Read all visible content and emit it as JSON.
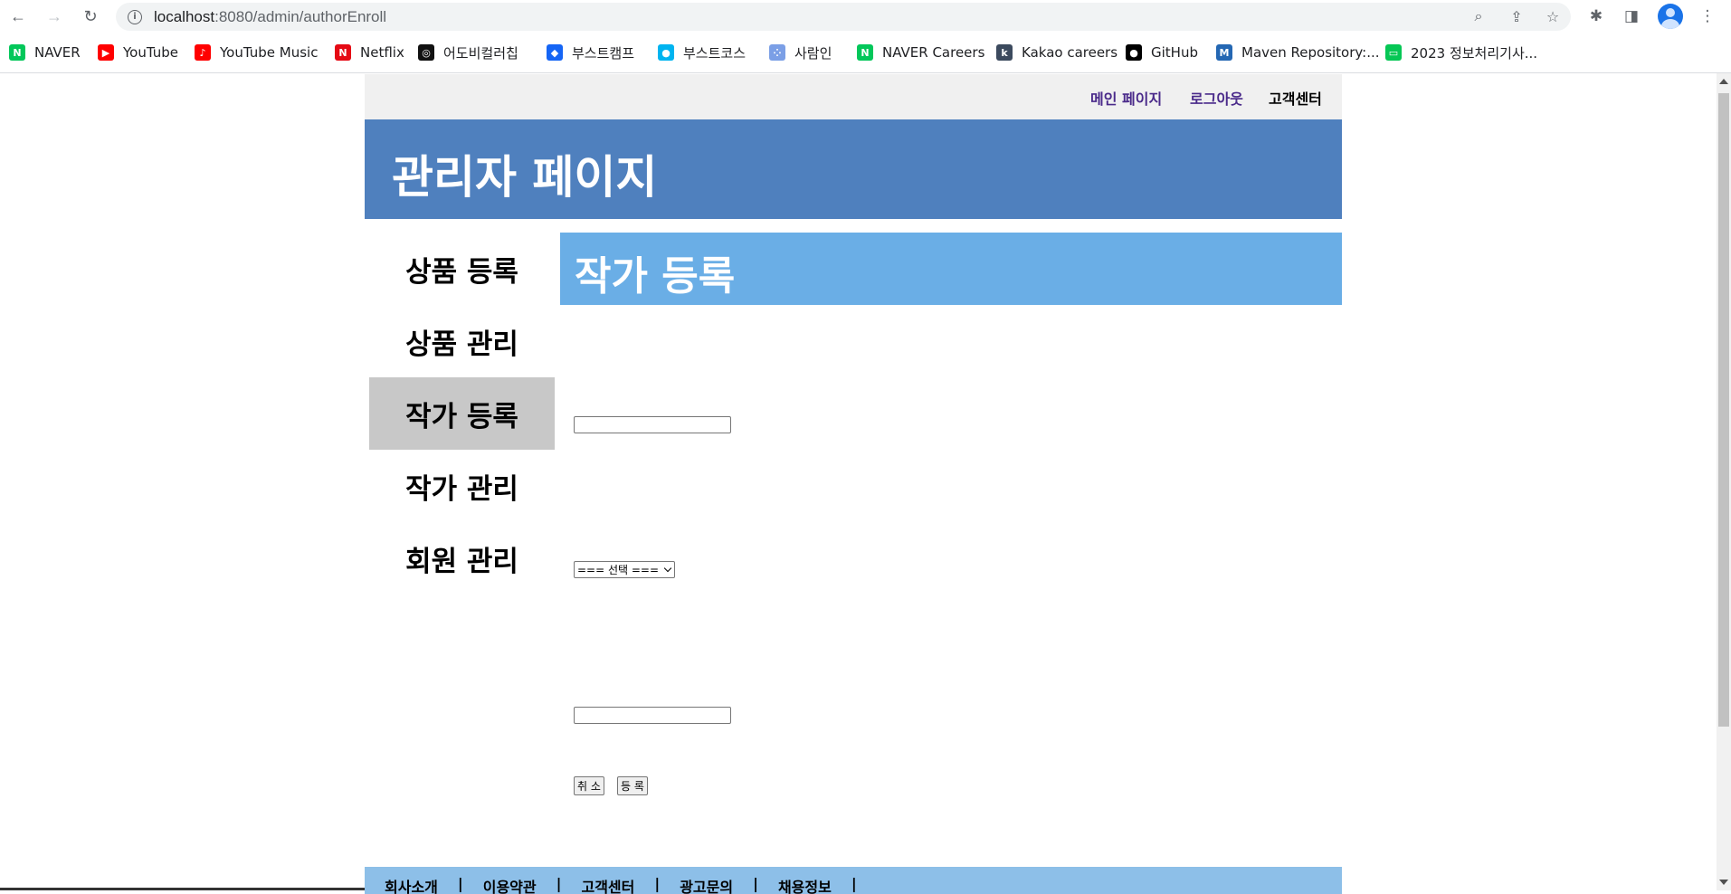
{
  "browser": {
    "url_host": "localhost",
    "url_rest": ":8080/admin/authorEnroll",
    "bookmarks": [
      {
        "label": "NAVER",
        "icon": "naver-icon",
        "color": "#03c75a",
        "glyph": "N"
      },
      {
        "label": "YouTube",
        "icon": "youtube-icon",
        "color": "#ff0000",
        "glyph": "▶"
      },
      {
        "label": "YouTube Music",
        "icon": "youtube-music-icon",
        "color": "#ff0000",
        "glyph": "♪"
      },
      {
        "label": "Netflix",
        "icon": "netflix-icon",
        "color": "#e50914",
        "glyph": "N"
      },
      {
        "label": "어도비컬러칩",
        "icon": "adobe-color-icon",
        "color": "#111111",
        "glyph": "◎"
      },
      {
        "label": "부스트캠프",
        "icon": "boostcamp-icon",
        "color": "#1565f5",
        "glyph": "◆"
      },
      {
        "label": "부스트코스",
        "icon": "boostcourse-icon",
        "color": "#00b4f0",
        "glyph": "●"
      },
      {
        "label": "사람인",
        "icon": "saramin-icon",
        "color": "#7b9fe6",
        "glyph": "⁘"
      },
      {
        "label": "NAVER Careers",
        "icon": "naver-careers-icon",
        "color": "#03c75a",
        "glyph": "N"
      },
      {
        "label": "Kakao careers",
        "icon": "kakao-careers-icon",
        "color": "#3c4a5e",
        "glyph": "k"
      },
      {
        "label": "GitHub",
        "icon": "github-icon",
        "color": "#000000",
        "glyph": "●"
      },
      {
        "label": "Maven Repository:...",
        "icon": "maven-icon",
        "color": "#2467b3",
        "glyph": "M"
      },
      {
        "label": "2023 정보처리기사...",
        "icon": "line-icon",
        "color": "#06c755",
        "glyph": "▭"
      }
    ]
  },
  "top_nav": {
    "main_page": "메인 페이지",
    "logout": "로그아웃",
    "customer_center": "고객센터"
  },
  "header": {
    "title": "관리자 페이지"
  },
  "sidebar": {
    "items": [
      {
        "label": "상품 등록"
      },
      {
        "label": "상품 관리"
      },
      {
        "label": "작가 등록"
      },
      {
        "label": "작가 관리"
      },
      {
        "label": "회원 관리"
      }
    ],
    "active": "작가 등록"
  },
  "content": {
    "title": "작가 등록",
    "name_value": "",
    "nation_selected": "=== 선택 ===",
    "intro_value": "",
    "cancel_label": "취 소",
    "enroll_label": "등 록"
  },
  "footer": {
    "items": [
      "회사소개",
      "이용약관",
      "고객센터",
      "광고문의",
      "채용정보"
    ],
    "separator": "|"
  }
}
